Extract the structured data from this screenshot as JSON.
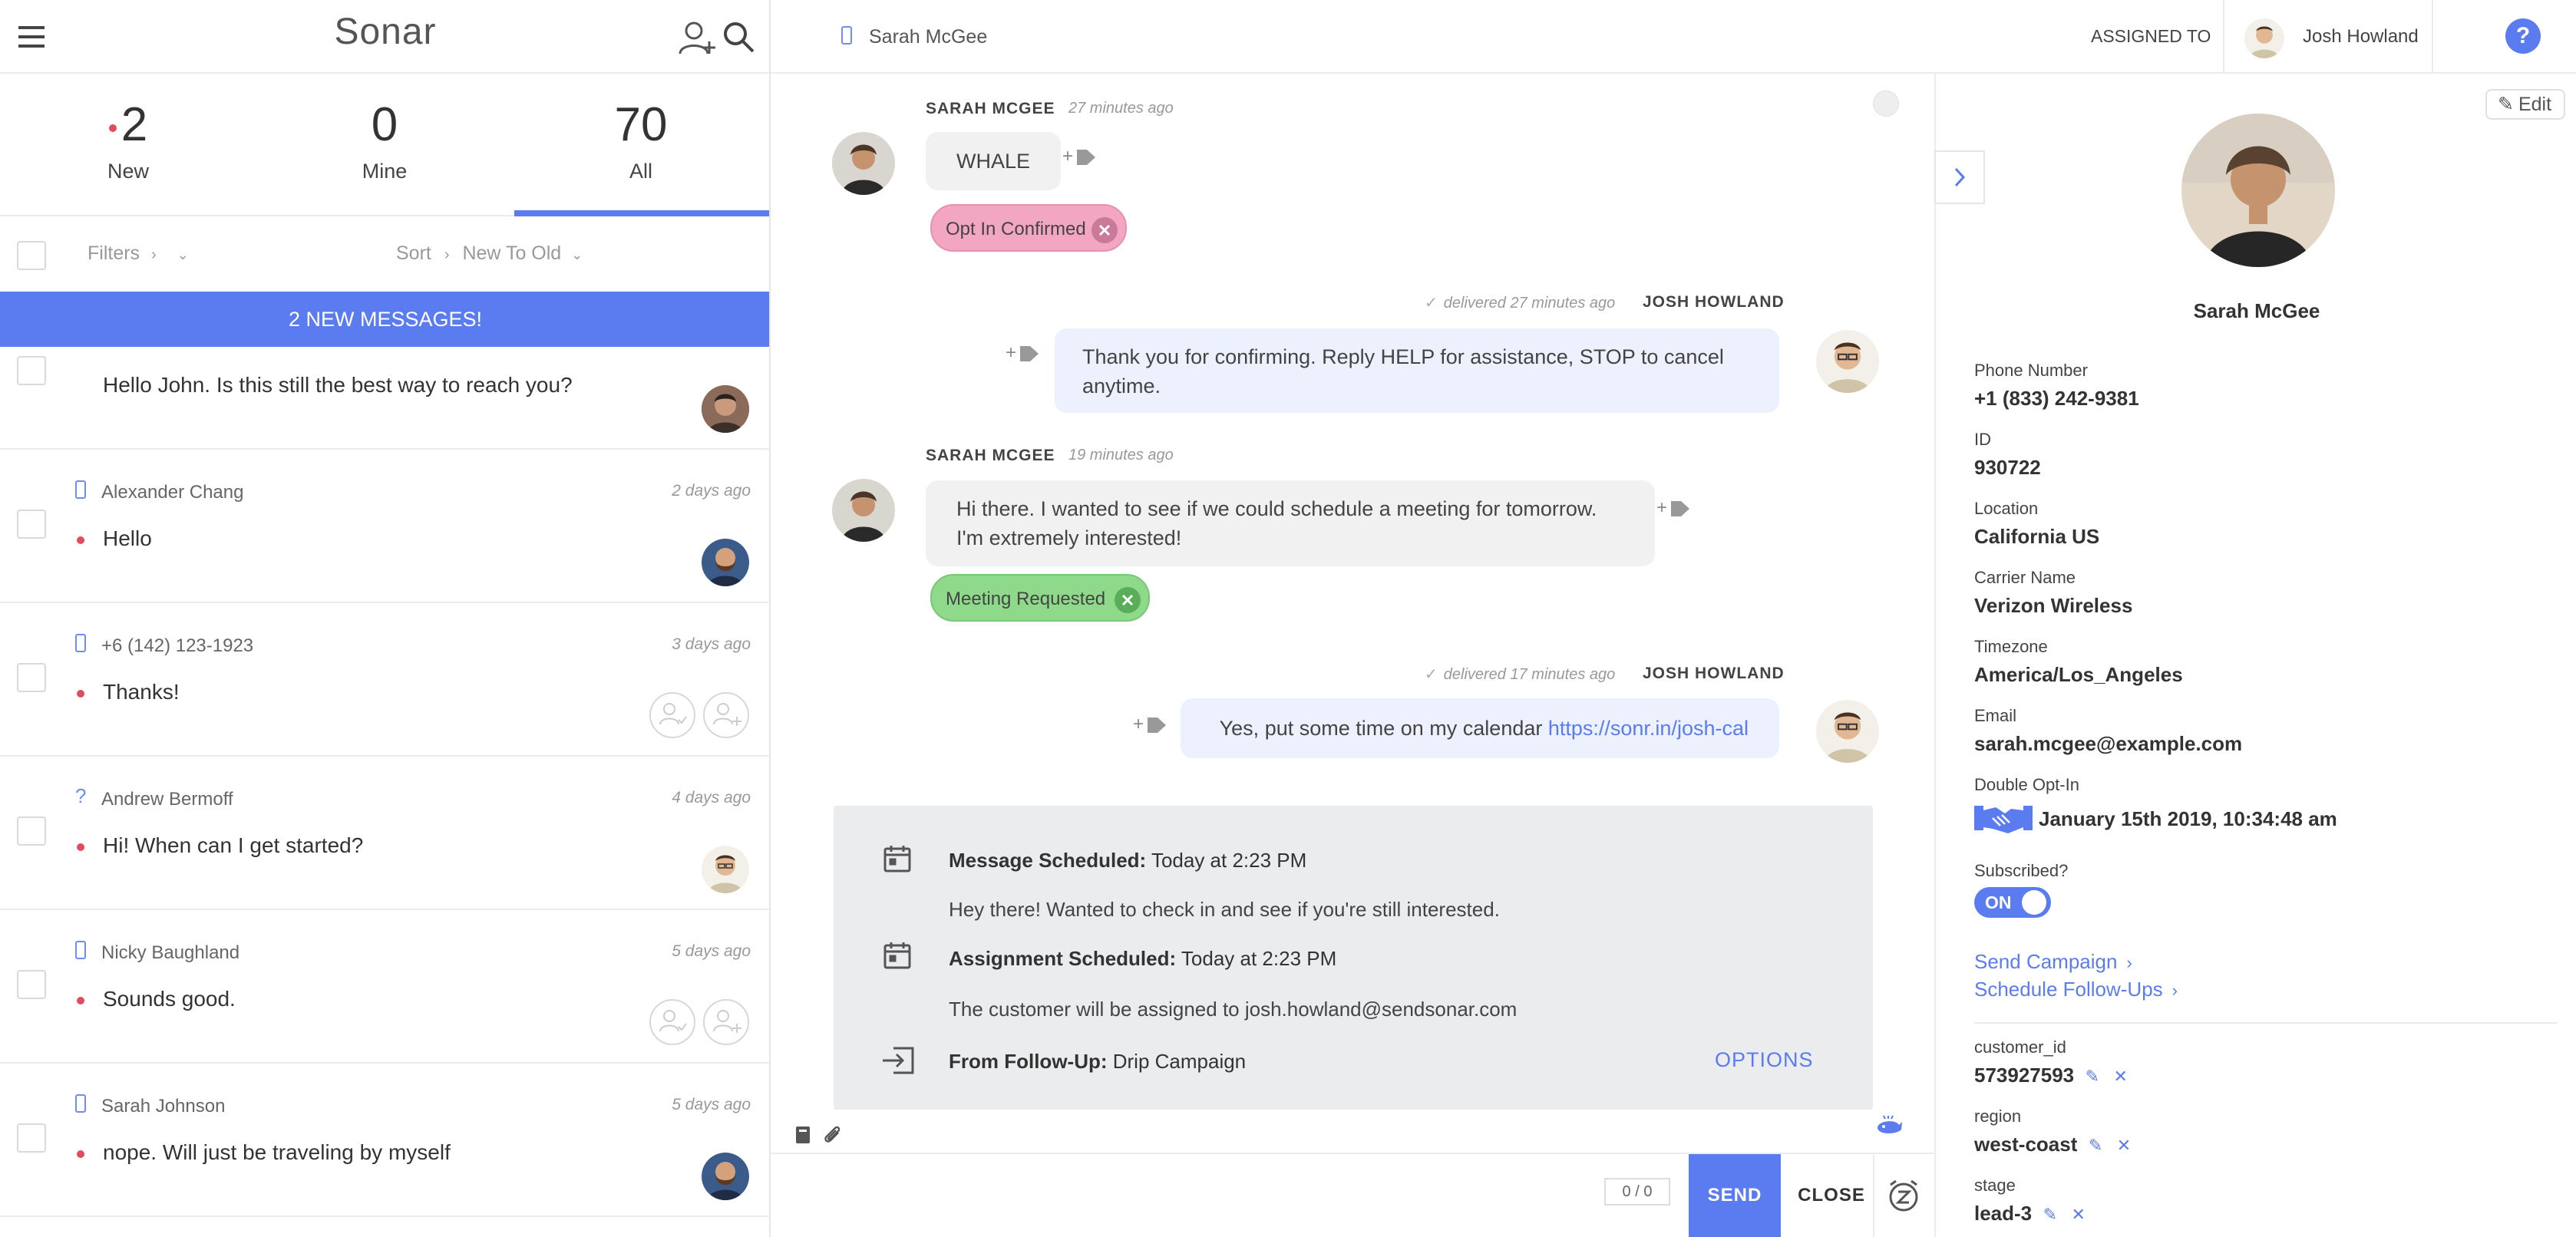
{
  "app": {
    "brand": "Sonar"
  },
  "counts": [
    {
      "number": "2",
      "label": "New"
    },
    {
      "number": "0",
      "label": "Mine"
    },
    {
      "number": "70",
      "label": "All"
    }
  ],
  "filterbar": {
    "filters_label": "Filters",
    "sort_label": "Sort",
    "sort_value": "New To Old"
  },
  "banner": "2 NEW MESSAGES!",
  "conversations": [
    {
      "name": "",
      "time": "",
      "message": "Hello John. Is this still the best way to reach you?"
    },
    {
      "name": "Alexander Chang",
      "time": "2 days ago",
      "message": "Hello"
    },
    {
      "name": "+6 (142) 123-1923",
      "time": "3 days ago",
      "message": "Thanks!"
    },
    {
      "name": "Andrew Bermoff",
      "time": "4 days ago",
      "message": "Hi! When can I get started?"
    },
    {
      "name": "Nicky Baughland",
      "time": "5 days ago",
      "message": "Sounds good."
    },
    {
      "name": "Sarah Johnson",
      "time": "5 days ago",
      "message": "nope. Will just be traveling by myself"
    }
  ],
  "header": {
    "contact_name": "Sarah McGee",
    "assigned_to_label": "ASSIGNED TO",
    "assignee": "Josh Howland"
  },
  "messages": [
    {
      "sender": "SARAH MCGEE",
      "ago": "27 minutes ago",
      "text": "WHALE",
      "tag": "Opt In Confirmed"
    },
    {
      "sender": "JOSH HOWLAND",
      "ago": "delivered 27 minutes ago",
      "text_line1": "Thank you for confirming. Reply HELP for assistance, STOP to cancel",
      "text_line2": "anytime."
    },
    {
      "sender": "SARAH MCGEE",
      "ago": "19 minutes ago",
      "text_line1": "Hi there. I wanted to see if we could schedule a meeting for tomorrow.",
      "text_line2": "I'm extremely interested!",
      "tag": "Meeting Requested"
    },
    {
      "sender": "JOSH HOWLAND",
      "ago": "delivered 17 minutes ago",
      "text": "Yes, put some time on my calendar ",
      "link": "https://sonr.in/josh-cal"
    }
  ],
  "scheduled": {
    "message_title": "Message Scheduled:",
    "message_when": " Today at 2:23 PM",
    "message_body": "Hey there! Wanted to check in and see if you're still interested.",
    "assignment_title": "Assignment Scheduled:",
    "assignment_when": " Today at 2:23 PM",
    "assignment_body": "The customer will be assigned to josh.howland@sendsonar.com",
    "followup_title": "From Follow-Up:",
    "followup_name": " Drip Campaign",
    "options_label": "OPTIONS"
  },
  "composer": {
    "counter": "0 / 0",
    "send_label": "SEND",
    "close_label": "CLOSE"
  },
  "profile": {
    "edit_label": "Edit",
    "name": "Sarah McGee",
    "fields": [
      {
        "label": "Phone Number",
        "value": "+1 (833) 242-9381"
      },
      {
        "label": "ID",
        "value": "930722"
      },
      {
        "label": "Location",
        "value": "California US"
      },
      {
        "label": "Carrier Name",
        "value": "Verizon Wireless"
      },
      {
        "label": "Timezone",
        "value": "America/Los_Angeles"
      },
      {
        "label": "Email",
        "value": "sarah.mcgee@example.com"
      }
    ],
    "double_opt_in_label": "Double Opt-In",
    "double_opt_in_value": "January 15th 2019, 10:34:48 am",
    "subscribed_label": "Subscribed?",
    "subscribed_value": "ON",
    "links": [
      "Send Campaign",
      "Schedule Follow-Ups"
    ],
    "custom_fields": [
      {
        "key": "customer_id",
        "value": "573927593"
      },
      {
        "key": "region",
        "value": "west-coast"
      },
      {
        "key": "stage",
        "value": "lead-3"
      }
    ]
  },
  "colors": {
    "accent": "#5b7cf0",
    "unread_dot": "#e14b5e",
    "tag_pink": "#f3a6c2",
    "tag_green": "#8ed98a"
  }
}
